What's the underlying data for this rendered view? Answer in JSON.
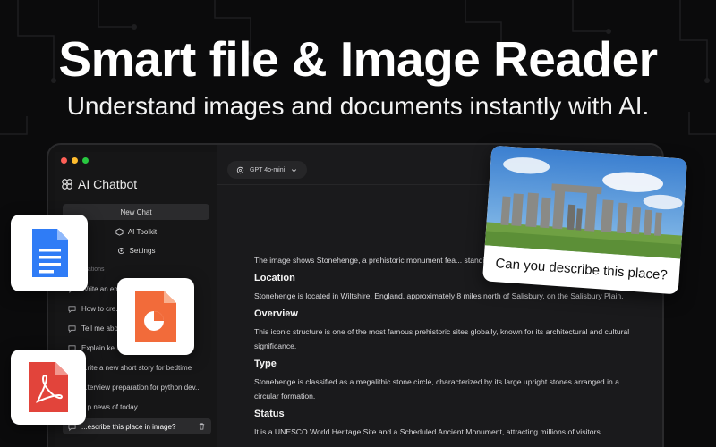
{
  "hero": {
    "title": "Smart file & Image Reader",
    "subtitle": "Understand images and documents instantly with AI."
  },
  "app": {
    "name": "AI Chatbot"
  },
  "sidebar": {
    "nav": [
      {
        "label": "New Chat",
        "icon": "chat-icon"
      },
      {
        "label": "AI Toolkit",
        "icon": "toolkit-icon"
      },
      {
        "label": "Settings",
        "icon": "gear-icon"
      }
    ],
    "section_label": "...ations",
    "conversations": [
      "Write an email... ex...",
      "How to cre...",
      "Tell me abo...",
      "Explain ke...",
      "...rite a new short story for bedtime",
      "...terview preparation for python dev...",
      "...p news of today",
      "...escribe this place in image?"
    ]
  },
  "toolbar": {
    "model": "GPT 4o-mini"
  },
  "answer": {
    "intro": "The image shows Stonehenge, a prehistoric monument fea... standing stones, with a clear blue sky above.",
    "sections": [
      {
        "heading": "Location",
        "text": "Stonehenge is located in Wiltshire, England, approximately 8 miles north of Salisbury, on the Salisbury Plain."
      },
      {
        "heading": "Overview",
        "text": "This iconic structure is one of the most famous prehistoric sites globally, known for its architectural and cultural significance."
      },
      {
        "heading": "Type",
        "text": "Stonehenge is classified as a megalithic stone circle, characterized by its large upright stones arranged in a circular formation."
      },
      {
        "heading": "Status",
        "text": "It is a UNESCO World Heritage Site and a Scheduled Ancient Monument, attracting millions of visitors"
      }
    ]
  },
  "photo_card": {
    "caption": "Can you describe this place?"
  },
  "colors": {
    "background": "#0b0b0c",
    "docs_blue": "#2f7cf6",
    "slides_orange": "#f26b3a",
    "pdf_red": "#e2443b"
  }
}
